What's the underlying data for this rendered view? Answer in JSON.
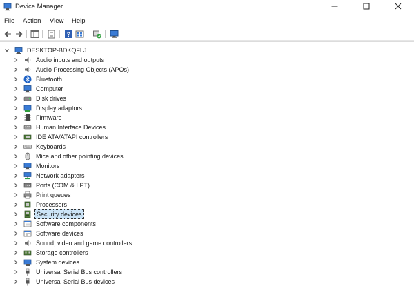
{
  "window": {
    "title": "Device Manager",
    "min_icon": "minimize-icon",
    "max_icon": "maximize-icon",
    "close_icon": "close-icon"
  },
  "menu": [
    "File",
    "Action",
    "View",
    "Help"
  ],
  "toolbar": [
    "back-icon",
    "forward-icon",
    "show-hide-console-tree-icon",
    "properties-icon",
    "help-icon",
    "view-icon",
    "update-driver-icon",
    "scan-hardware-icon"
  ],
  "tree": {
    "root": "DESKTOP-BDKQFLJ",
    "selected_index": 16,
    "items": [
      {
        "label": "Audio inputs and outputs",
        "icon": "speaker-icon"
      },
      {
        "label": "Audio Processing Objects (APOs)",
        "icon": "speaker-icon"
      },
      {
        "label": "Bluetooth",
        "icon": "bluetooth-icon"
      },
      {
        "label": "Computer",
        "icon": "computer-icon"
      },
      {
        "label": "Disk drives",
        "icon": "disk-drive-icon"
      },
      {
        "label": "Display adaptors",
        "icon": "display-adapter-icon"
      },
      {
        "label": "Firmware",
        "icon": "firmware-icon"
      },
      {
        "label": "Human Interface Devices",
        "icon": "hid-icon"
      },
      {
        "label": "IDE ATA/ATAPI controllers",
        "icon": "ide-controller-icon"
      },
      {
        "label": "Keyboards",
        "icon": "keyboard-icon"
      },
      {
        "label": "Mice and other pointing devices",
        "icon": "mouse-icon"
      },
      {
        "label": "Monitors",
        "icon": "monitor-icon"
      },
      {
        "label": "Network adapters",
        "icon": "network-adapter-icon"
      },
      {
        "label": "Ports (COM & LPT)",
        "icon": "port-icon"
      },
      {
        "label": "Print queues",
        "icon": "printer-icon"
      },
      {
        "label": "Processors",
        "icon": "processor-icon"
      },
      {
        "label": "Security devices",
        "icon": "security-device-icon"
      },
      {
        "label": "Software components",
        "icon": "software-component-icon"
      },
      {
        "label": "Software devices",
        "icon": "software-device-icon"
      },
      {
        "label": "Sound, video and game controllers",
        "icon": "sound-icon"
      },
      {
        "label": "Storage controllers",
        "icon": "storage-controller-icon"
      },
      {
        "label": "System devices",
        "icon": "system-device-icon"
      },
      {
        "label": "Universal Serial Bus controllers",
        "icon": "usb-icon"
      },
      {
        "label": "Universal Serial Bus devices",
        "icon": "usb-icon"
      }
    ]
  }
}
